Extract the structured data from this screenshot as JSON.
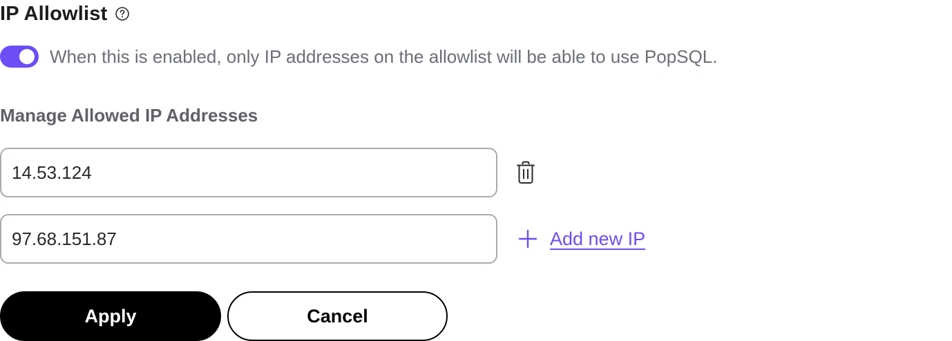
{
  "header": {
    "title": "IP Allowlist",
    "help_icon": "question-circle-icon"
  },
  "allowlist_toggle": {
    "enabled": true,
    "description": "When this is enabled, only IP addresses on the allowlist will be able to use PopSQL.",
    "accent_color": "#6c4df6"
  },
  "manage": {
    "label": "Manage Allowed IP Addresses",
    "entries": [
      {
        "value": "14.53.124",
        "action_icon": "trash-icon"
      },
      {
        "value": "97.68.151.87",
        "action_icon": "plus-icon"
      }
    ],
    "add_label": "Add new IP"
  },
  "actions": {
    "apply_label": "Apply",
    "cancel_label": "Cancel"
  }
}
